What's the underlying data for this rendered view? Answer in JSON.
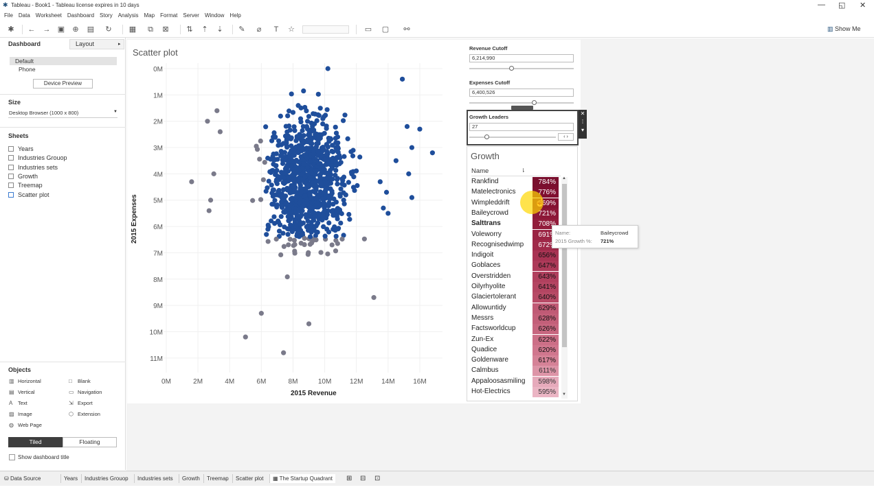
{
  "app": {
    "title": "Tableau - Book1 - Tableau license expires in 10 days",
    "window_controls": {
      "minimize": "—",
      "restore": "◱",
      "close": "✕"
    }
  },
  "menu": [
    "File",
    "Data",
    "Worksheet",
    "Dashboard",
    "Story",
    "Analysis",
    "Map",
    "Format",
    "Server",
    "Window",
    "Help"
  ],
  "toolbar": {
    "show_me": "Show Me"
  },
  "left_panel": {
    "tabs": {
      "dashboard": "Dashboard",
      "layout": "Layout"
    },
    "devices": [
      "Default",
      "Phone"
    ],
    "device_preview": "Device Preview",
    "size_header": "Size",
    "size_value": "Desktop Browser (1000 x 800)",
    "sheets_header": "Sheets",
    "sheets": [
      "Years",
      "Industries Grouop",
      "Industries sets",
      "Growth",
      "Treemap",
      "Scatter plot"
    ],
    "objects_header": "Objects",
    "objects_left": [
      "Horizontal",
      "Vertical",
      "Text",
      "Image",
      "Web Page"
    ],
    "objects_right": [
      "Blank",
      "Navigation",
      "Export",
      "Extension"
    ],
    "tiled": "Tiled",
    "floating": "Floating",
    "show_title": "Show dashboard title"
  },
  "scatter": {
    "title": "Scatter plot"
  },
  "chart_data": {
    "type": "scatter",
    "xlabel": "2015 Revenue",
    "ylabel": "2015 Expenses",
    "x_ticks": [
      "0M",
      "2M",
      "4M",
      "6M",
      "8M",
      "10M",
      "12M",
      "14M",
      "16M"
    ],
    "y_ticks": [
      "0M",
      "1M",
      "2M",
      "3M",
      "4M",
      "5M",
      "6M",
      "7M",
      "8M",
      "9M",
      "10M",
      "11M"
    ],
    "xlim": [
      0,
      17000000
    ],
    "ylim": [
      0,
      11500000
    ],
    "colors": {
      "above_cutoff": "#1f4e9b",
      "below_cutoff": "#7a7a8a"
    },
    "outlier_points": [
      [
        14900000,
        400000
      ],
      [
        15200000,
        2200000
      ],
      [
        16000000,
        2300000
      ],
      [
        15500000,
        3000000
      ],
      [
        16800000,
        3200000
      ],
      [
        15300000,
        4000000
      ],
      [
        14500000,
        3500000
      ],
      [
        13500000,
        4300000
      ],
      [
        13700000,
        5300000
      ],
      [
        14000000,
        5500000
      ],
      [
        13900000,
        4700000
      ],
      [
        15500000,
        4900000
      ],
      [
        1600000,
        4300000
      ],
      [
        3000000,
        4000000
      ],
      [
        2800000,
        5000000
      ],
      [
        2700000,
        5400000
      ],
      [
        3200000,
        1600000
      ],
      [
        2600000,
        2000000
      ],
      [
        3400000,
        2400000
      ],
      [
        10200000,
        0
      ],
      [
        6000000,
        9300000
      ],
      [
        9000000,
        9700000
      ],
      [
        7400000,
        10800000
      ],
      [
        13100000,
        8700000
      ],
      [
        5000000,
        10200000
      ]
    ]
  },
  "controls": {
    "revenue": {
      "title": "Revenue Cutoff",
      "value": "6,214,990",
      "level": 0.4
    },
    "expenses": {
      "title": "Expenses Cutoff",
      "value": "6,400,526",
      "level": 0.62
    },
    "growth_leaders": {
      "title": "Growth Leaders",
      "value": "27",
      "level": 0.2
    }
  },
  "growth": {
    "title": "Growth",
    "col_name": "Name",
    "rows": [
      {
        "name": "Rankfind",
        "value": "784%",
        "color": "#7a0f2e"
      },
      {
        "name": "Matelectronics",
        "value": "776%",
        "color": "#800f30"
      },
      {
        "name": "Wimpleddrift",
        "value": "769%",
        "color": "#851232"
      },
      {
        "name": "Baileycrowd",
        "value": "721%",
        "color": "#8d1838"
      },
      {
        "name": "Salttrans",
        "value": "708%",
        "color": "#921c3b"
      },
      {
        "name": "Voleworry",
        "value": "691%",
        "color": "#9a2343"
      },
      {
        "name": "Recognisedwimp",
        "value": "672%",
        "color": "#a02a4a"
      },
      {
        "name": "Indigoit",
        "value": "656%",
        "color": "#a83353"
      },
      {
        "name": "Goblaces",
        "value": "647%",
        "color": "#ad3a59"
      },
      {
        "name": "Overstridden",
        "value": "643%",
        "color": "#b1405e"
      },
      {
        "name": "Oilyrhyolite",
        "value": "641%",
        "color": "#b44562"
      },
      {
        "name": "Glaciertolerant",
        "value": "640%",
        "color": "#b74a66"
      },
      {
        "name": "Allowuntidy",
        "value": "629%",
        "color": "#c05a75"
      },
      {
        "name": "Messrs",
        "value": "628%",
        "color": "#c35f79"
      },
      {
        "name": "Factsworldcup",
        "value": "626%",
        "color": "#c7667f"
      },
      {
        "name": "Zun-Ex",
        "value": "622%",
        "color": "#cc6f87"
      },
      {
        "name": "Quadice",
        "value": "620%",
        "color": "#d0778e"
      },
      {
        "name": "Goldenware",
        "value": "617%",
        "color": "#d58297"
      },
      {
        "name": "Calmbus",
        "value": "611%",
        "color": "#dd94a7"
      },
      {
        "name": "Appaloosasmiling",
        "value": "598%",
        "color": "#e6aabb"
      },
      {
        "name": "Hot-Electrics",
        "value": "595%",
        "color": "#ebb5c4"
      }
    ]
  },
  "tooltip": {
    "name_label": "Name:",
    "name_value": "Baileycrowd",
    "growth_label": "2015 Growth %:",
    "growth_value": "721%"
  },
  "bottom_tabs": [
    "Data Source",
    "Years",
    "Industries Grouop",
    "Industries sets",
    "Growth",
    "Treemap",
    "Scatter plot",
    "The Startup Quadrant"
  ]
}
